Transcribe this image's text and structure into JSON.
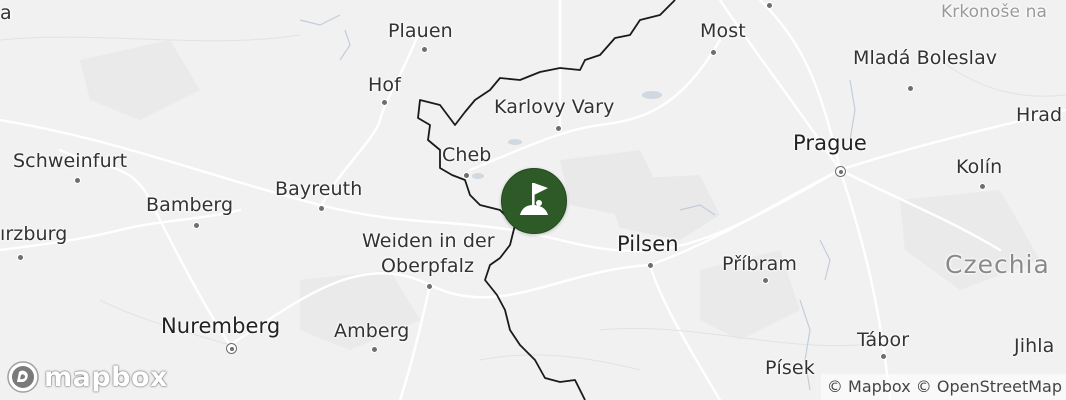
{
  "map": {
    "labels": {
      "plauen": "Plauen",
      "most": "Most",
      "krkonose": "Krkonoše na",
      "mlada_boleslav": "Mladá Boleslav",
      "hof": "Hof",
      "karlovy_vary": "Karlovy Vary",
      "hrad": "Hrad",
      "cheb": "Cheb",
      "prague": "Prague",
      "schweinfurt": "Schweinfurt",
      "kolin": "Kolín",
      "bayreuth": "Bayreuth",
      "bamberg": "Bamberg",
      "wurzburg": "ırzburg",
      "weiden_line1": "Weiden in der",
      "weiden_line2": "Oberpfalz",
      "pilsen": "Pilsen",
      "pribram": "Příbram",
      "czechia": "Czechia",
      "nuremberg": "Nuremberg",
      "amberg": "Amberg",
      "tabor": "Tábor",
      "jihla": "Jihla",
      "pisek": "Písek",
      "a_partial": "a"
    },
    "marker": {
      "icon": "golf-flag-icon",
      "color": "#2d5a27"
    }
  },
  "logo": {
    "text": "mapbox",
    "icon": "mapbox-logo-icon"
  },
  "attribution": {
    "mapbox": "© Mapbox",
    "osm": "© OpenStreetMap"
  }
}
